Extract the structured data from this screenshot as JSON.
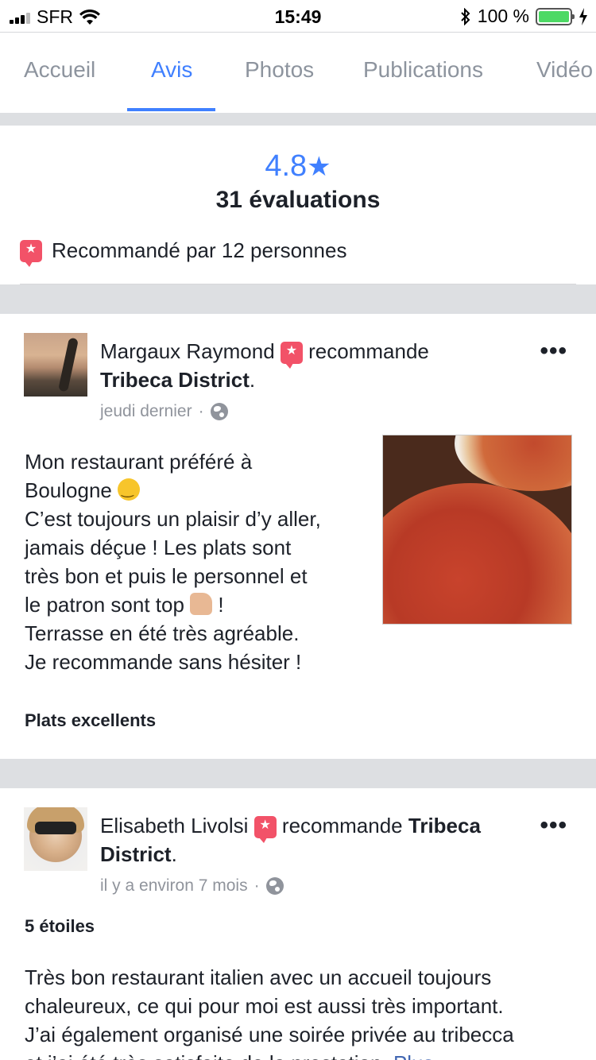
{
  "status_bar": {
    "carrier": "SFR",
    "time": "15:49",
    "battery": "100 %"
  },
  "tabs": [
    {
      "label": "Accueil",
      "active": false
    },
    {
      "label": "Avis",
      "active": true
    },
    {
      "label": "Photos",
      "active": false
    },
    {
      "label": "Publications",
      "active": false
    },
    {
      "label": "Vidéo",
      "active": false
    }
  ],
  "summary": {
    "score": "4.8",
    "star": "★",
    "ratings_count": "31 évaluations",
    "recommended_text": "Recommandé par 12 personnes",
    "accent_color": "#4080ff",
    "recommend_color": "#f25268"
  },
  "reviews": [
    {
      "author": "Margaux Raymond",
      "verb": "recommande",
      "place": "Tribeca District",
      "punct": ".",
      "time": "jeudi dernier",
      "separator": "·",
      "text_lines": [
        "Mon restaurant préféré à",
        "Boulogne",
        "C’est toujours un plaisir d’y aller,",
        "jamais déçue ! Les plats sont",
        "très bon et puis le personnel et",
        "le patron sont top",
        "!",
        "Terrasse en été très agréable.",
        "Je recommande sans hésiter !"
      ],
      "tag": "Plats excellents"
    },
    {
      "author": "Elisabeth Livolsi",
      "verb": "recommande",
      "place_part1": "Tribeca",
      "place_part2": "District",
      "punct": ".",
      "time": "il y a environ 7 mois",
      "separator": "·",
      "tag": "5 étoiles",
      "text_lines": [
        "Très bon restaurant italien avec un accueil toujours",
        "chaleureux, ce qui pour moi est aussi très important.",
        "J’ai également organisé une soirée privée au tribecca",
        "et j’ai été très satisfaite de la prestation.",
        "Plus"
      ]
    }
  ],
  "icons": {
    "more": "•••",
    "recommend": "★"
  }
}
